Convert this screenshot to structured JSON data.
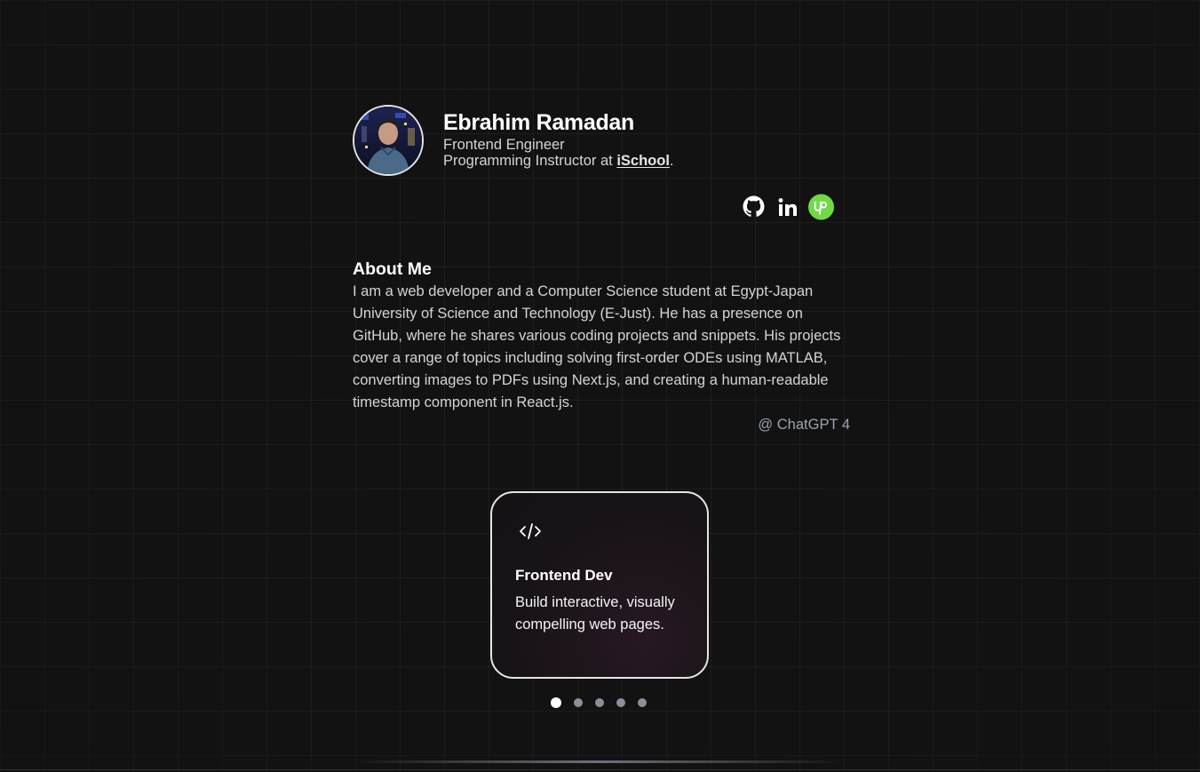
{
  "profile": {
    "name": "Ebrahim Ramadan",
    "role": "Frontend Engineer",
    "instructor_prefix": "Programming Instructor at ",
    "instructor_org": "iSchool",
    "instructor_suffix": "."
  },
  "socials": [
    {
      "name": "github-icon",
      "label": "GitHub"
    },
    {
      "name": "linkedin-icon",
      "label": "LinkedIn"
    },
    {
      "name": "upwork-icon",
      "label": "Upwork",
      "color": "#6fda44"
    }
  ],
  "about": {
    "heading": "About Me",
    "body": "I am a web developer and a Computer Science student at Egypt-Japan University of Science and Technology (E-Just). He has a presence on GitHub, where he shares various coding projects and snippets. His projects cover a range of topics including solving first-order ODEs using MATLAB, converting images to PDFs using Next.js, and creating a human-readable timestamp component in React.js.",
    "credit": "@ ChatGPT 4"
  },
  "carousel": {
    "active_index": 0,
    "total": 5,
    "card": {
      "icon": "code-icon",
      "title": "Frontend Dev",
      "description": "Build interactive, visually compelling web pages."
    }
  },
  "colors": {
    "background": "#121212",
    "accent_upwork": "#6fda44",
    "dot_inactive": "#8b8f98",
    "dot_active": "#ffffff"
  }
}
